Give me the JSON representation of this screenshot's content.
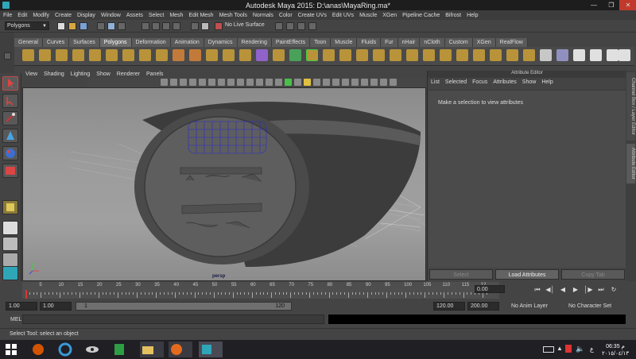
{
  "window": {
    "title": "Autodesk Maya 2015: D:\\anas\\MayaRing.ma*"
  },
  "menubar": [
    "File",
    "Edit",
    "Modify",
    "Create",
    "Display",
    "Window",
    "Assets",
    "Select",
    "Mesh",
    "Edit Mesh",
    "Mesh Tools",
    "Normals",
    "Color",
    "Create UVs",
    "Edit UVs",
    "Muscle",
    "XGen",
    "Pipeline Cache",
    "Bifrost",
    "Help"
  ],
  "statusline": {
    "mode": "Polygons",
    "live_surface": "No Live Surface"
  },
  "shelf": {
    "tabs": [
      "General",
      "Curves",
      "Surfaces",
      "Polygons",
      "Deformation",
      "Animation",
      "Dynamics",
      "Rendering",
      "PaintEffects",
      "Toon",
      "Muscle",
      "Fluids",
      "Fur",
      "nHair",
      "nCloth",
      "Custom",
      "XGen",
      "RealFlow"
    ],
    "active": "Polygons"
  },
  "viewport": {
    "menu": [
      "View",
      "Shading",
      "Lighting",
      "Show",
      "Renderer",
      "Panels"
    ],
    "camera": "persp"
  },
  "attribute_editor": {
    "title": "Attribute Editor",
    "menu": [
      "List",
      "Selected",
      "Focus",
      "Attributes",
      "Show",
      "Help"
    ],
    "message": "Make a selection to view attributes",
    "buttons": [
      "Select",
      "Load Attributes",
      "Copy Tab"
    ]
  },
  "side_tabs": [
    "Channel Box / Layer Editor",
    "Attribute Editor"
  ],
  "timeline": {
    "ticks": [
      "5",
      "10",
      "15",
      "20",
      "25",
      "30",
      "35",
      "40",
      "45",
      "50",
      "55",
      "60",
      "65",
      "70",
      "75",
      "80",
      "85",
      "90",
      "95",
      "100",
      "105",
      "110",
      "115",
      "12"
    ],
    "current_frame": "0.00"
  },
  "range": {
    "start": "1.00",
    "playback_start": "1.00",
    "slider_left": "1",
    "slider_right": "120",
    "playback_end": "120.00",
    "end": "200.00",
    "anim_layer": "No Anim Layer",
    "character_set": "No Character Set"
  },
  "command_line": {
    "label": "MEL"
  },
  "help_line": "Select Tool: select an object",
  "taskbar": {
    "clock_time": "06:35 م",
    "clock_date": "٢٠١٥/٠٤/١٣",
    "lang": "ع"
  }
}
